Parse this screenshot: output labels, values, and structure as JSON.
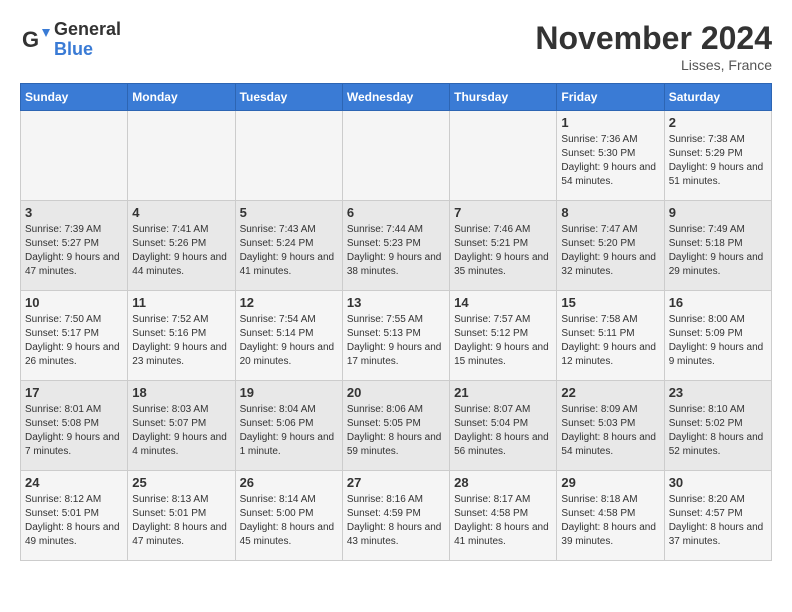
{
  "header": {
    "logo_general": "General",
    "logo_blue": "Blue",
    "month_title": "November 2024",
    "location": "Lisses, France"
  },
  "days_of_week": [
    "Sunday",
    "Monday",
    "Tuesday",
    "Wednesday",
    "Thursday",
    "Friday",
    "Saturday"
  ],
  "weeks": [
    [
      {
        "day": "",
        "info": ""
      },
      {
        "day": "",
        "info": ""
      },
      {
        "day": "",
        "info": ""
      },
      {
        "day": "",
        "info": ""
      },
      {
        "day": "",
        "info": ""
      },
      {
        "day": "1",
        "info": "Sunrise: 7:36 AM\nSunset: 5:30 PM\nDaylight: 9 hours and 54 minutes."
      },
      {
        "day": "2",
        "info": "Sunrise: 7:38 AM\nSunset: 5:29 PM\nDaylight: 9 hours and 51 minutes."
      }
    ],
    [
      {
        "day": "3",
        "info": "Sunrise: 7:39 AM\nSunset: 5:27 PM\nDaylight: 9 hours and 47 minutes."
      },
      {
        "day": "4",
        "info": "Sunrise: 7:41 AM\nSunset: 5:26 PM\nDaylight: 9 hours and 44 minutes."
      },
      {
        "day": "5",
        "info": "Sunrise: 7:43 AM\nSunset: 5:24 PM\nDaylight: 9 hours and 41 minutes."
      },
      {
        "day": "6",
        "info": "Sunrise: 7:44 AM\nSunset: 5:23 PM\nDaylight: 9 hours and 38 minutes."
      },
      {
        "day": "7",
        "info": "Sunrise: 7:46 AM\nSunset: 5:21 PM\nDaylight: 9 hours and 35 minutes."
      },
      {
        "day": "8",
        "info": "Sunrise: 7:47 AM\nSunset: 5:20 PM\nDaylight: 9 hours and 32 minutes."
      },
      {
        "day": "9",
        "info": "Sunrise: 7:49 AM\nSunset: 5:18 PM\nDaylight: 9 hours and 29 minutes."
      }
    ],
    [
      {
        "day": "10",
        "info": "Sunrise: 7:50 AM\nSunset: 5:17 PM\nDaylight: 9 hours and 26 minutes."
      },
      {
        "day": "11",
        "info": "Sunrise: 7:52 AM\nSunset: 5:16 PM\nDaylight: 9 hours and 23 minutes."
      },
      {
        "day": "12",
        "info": "Sunrise: 7:54 AM\nSunset: 5:14 PM\nDaylight: 9 hours and 20 minutes."
      },
      {
        "day": "13",
        "info": "Sunrise: 7:55 AM\nSunset: 5:13 PM\nDaylight: 9 hours and 17 minutes."
      },
      {
        "day": "14",
        "info": "Sunrise: 7:57 AM\nSunset: 5:12 PM\nDaylight: 9 hours and 15 minutes."
      },
      {
        "day": "15",
        "info": "Sunrise: 7:58 AM\nSunset: 5:11 PM\nDaylight: 9 hours and 12 minutes."
      },
      {
        "day": "16",
        "info": "Sunrise: 8:00 AM\nSunset: 5:09 PM\nDaylight: 9 hours and 9 minutes."
      }
    ],
    [
      {
        "day": "17",
        "info": "Sunrise: 8:01 AM\nSunset: 5:08 PM\nDaylight: 9 hours and 7 minutes."
      },
      {
        "day": "18",
        "info": "Sunrise: 8:03 AM\nSunset: 5:07 PM\nDaylight: 9 hours and 4 minutes."
      },
      {
        "day": "19",
        "info": "Sunrise: 8:04 AM\nSunset: 5:06 PM\nDaylight: 9 hours and 1 minute."
      },
      {
        "day": "20",
        "info": "Sunrise: 8:06 AM\nSunset: 5:05 PM\nDaylight: 8 hours and 59 minutes."
      },
      {
        "day": "21",
        "info": "Sunrise: 8:07 AM\nSunset: 5:04 PM\nDaylight: 8 hours and 56 minutes."
      },
      {
        "day": "22",
        "info": "Sunrise: 8:09 AM\nSunset: 5:03 PM\nDaylight: 8 hours and 54 minutes."
      },
      {
        "day": "23",
        "info": "Sunrise: 8:10 AM\nSunset: 5:02 PM\nDaylight: 8 hours and 52 minutes."
      }
    ],
    [
      {
        "day": "24",
        "info": "Sunrise: 8:12 AM\nSunset: 5:01 PM\nDaylight: 8 hours and 49 minutes."
      },
      {
        "day": "25",
        "info": "Sunrise: 8:13 AM\nSunset: 5:01 PM\nDaylight: 8 hours and 47 minutes."
      },
      {
        "day": "26",
        "info": "Sunrise: 8:14 AM\nSunset: 5:00 PM\nDaylight: 8 hours and 45 minutes."
      },
      {
        "day": "27",
        "info": "Sunrise: 8:16 AM\nSunset: 4:59 PM\nDaylight: 8 hours and 43 minutes."
      },
      {
        "day": "28",
        "info": "Sunrise: 8:17 AM\nSunset: 4:58 PM\nDaylight: 8 hours and 41 minutes."
      },
      {
        "day": "29",
        "info": "Sunrise: 8:18 AM\nSunset: 4:58 PM\nDaylight: 8 hours and 39 minutes."
      },
      {
        "day": "30",
        "info": "Sunrise: 8:20 AM\nSunset: 4:57 PM\nDaylight: 8 hours and 37 minutes."
      }
    ]
  ]
}
